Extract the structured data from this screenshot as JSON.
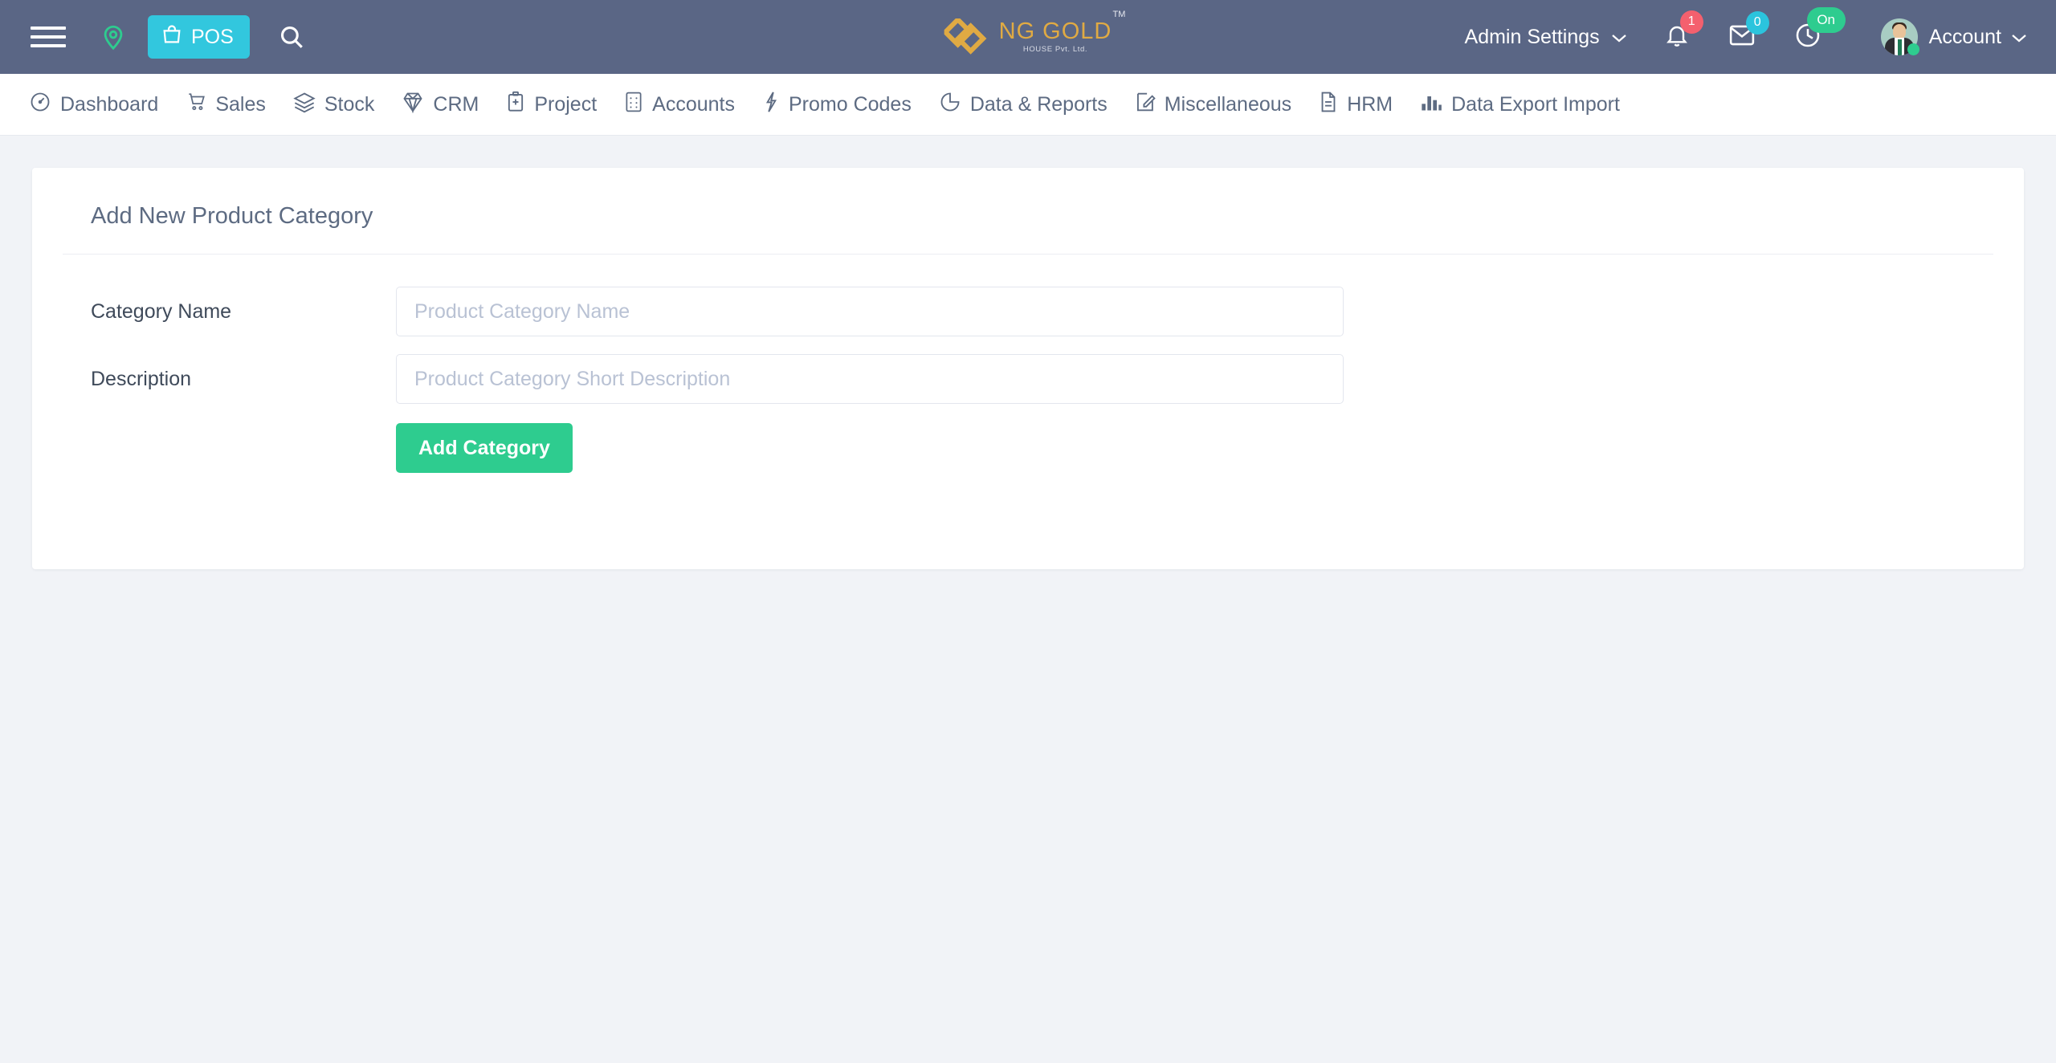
{
  "header": {
    "menu_icon": "hamburger-icon",
    "location_icon": "map-pin-icon",
    "pos_label": "POS",
    "pos_icon": "shopping-bag-icon",
    "search_icon": "search-icon",
    "logo": {
      "main": "NG GOLD",
      "sub": "HOUSE Pvt. Ltd.",
      "tm": "TM"
    },
    "admin_settings_label": "Admin Settings",
    "notifications": {
      "icon": "bell-icon",
      "count": "1",
      "color": "#f4606e"
    },
    "messages": {
      "icon": "envelope-icon",
      "count": "0",
      "color": "#2bc4dd"
    },
    "clock": {
      "icon": "clock-icon",
      "status": "On",
      "color": "#2ecc8f"
    },
    "account_label": "Account",
    "avatar_icon": "user-avatar",
    "chevron_icon": "chevron-down-icon"
  },
  "nav": {
    "items": [
      {
        "label": "Dashboard",
        "icon": "speedometer-icon"
      },
      {
        "label": "Sales",
        "icon": "shopping-cart-icon"
      },
      {
        "label": "Stock",
        "icon": "layers-icon"
      },
      {
        "label": "CRM",
        "icon": "diamond-icon"
      },
      {
        "label": "Project",
        "icon": "briefcase-icon"
      },
      {
        "label": "Accounts",
        "icon": "calculator-icon"
      },
      {
        "label": "Promo Codes",
        "icon": "lightning-bolt-icon"
      },
      {
        "label": "Data & Reports",
        "icon": "pie-chart-icon"
      },
      {
        "label": "Miscellaneous",
        "icon": "edit-square-icon"
      },
      {
        "label": "HRM",
        "icon": "document-icon"
      },
      {
        "label": "Data Export Import",
        "icon": "bar-chart-icon"
      }
    ]
  },
  "card": {
    "title": "Add New Product Category",
    "fields": [
      {
        "label": "Category Name",
        "placeholder": "Product Category Name",
        "value": ""
      },
      {
        "label": "Description",
        "placeholder": "Product Category Short Description",
        "value": ""
      }
    ],
    "submit_label": "Add Category"
  },
  "colors": {
    "header_bg": "#5a6685",
    "pos_btn": "#32c7de",
    "accent_green": "#2ecc8f",
    "logo_gold": "#e0aa43",
    "page_bg": "#f1f3f7",
    "nav_text": "#5d6b82"
  }
}
